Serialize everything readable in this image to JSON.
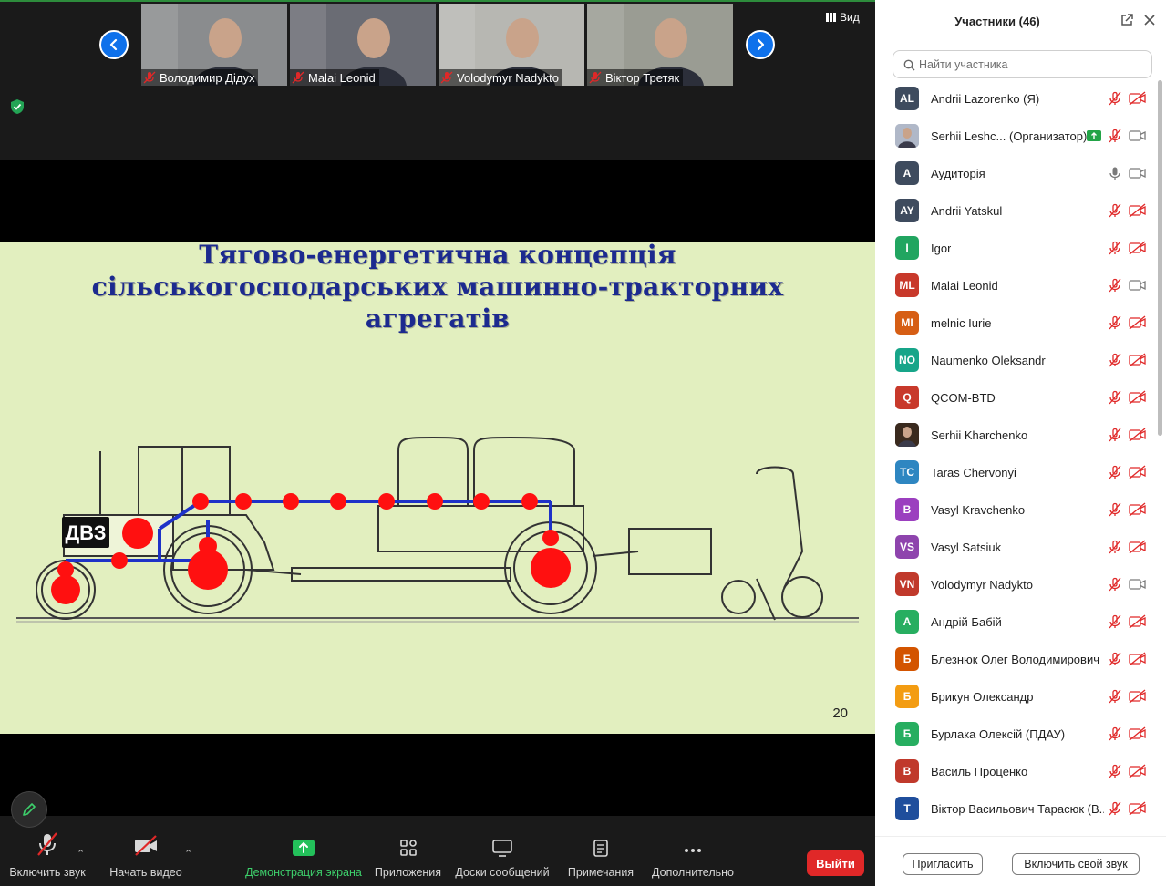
{
  "gallery": {
    "tiles": [
      {
        "name": "Володимир Дідух",
        "bg": "#8a8c8e"
      },
      {
        "name": "Malai Leonid",
        "bg": "#6a6c74"
      },
      {
        "name": "Volodymyr Nadykto",
        "bg": "#b7b7b2"
      },
      {
        "name": "Віктор Третяк",
        "bg": "#9a9c93"
      }
    ],
    "view_label": "Вид"
  },
  "slide": {
    "title_lines": [
      "Тягово-енергетична концепція",
      "сільськогосподарських машинно-тракторних",
      "агрегатів"
    ],
    "engine_label": "ДВЗ",
    "page_number": "20"
  },
  "toolbar": {
    "unmute": "Включить звук",
    "start_video": "Начать видео",
    "share_screen": "Демонстрация экрана",
    "apps": "Приложения",
    "whiteboards": "Доски сообщений",
    "notes": "Примечания",
    "more": "Дополнительно",
    "leave": "Выйти"
  },
  "panel": {
    "title": "Участники (46)",
    "search_placeholder": "Найти участника",
    "participants": [
      {
        "initials": "AL",
        "name": "Andrii Lazorenko (Я)",
        "color": "#3e4b5e",
        "mic": "muted",
        "cam": "off"
      },
      {
        "initials": "",
        "name": "Serhii Leshc... (Организатор)",
        "color": "#b0b8c8",
        "mic": "muted",
        "cam": "on",
        "photo": true,
        "sharing": true
      },
      {
        "initials": "A",
        "name": "Аудиторія",
        "color": "#3e4b5e",
        "mic": "on",
        "cam": "on"
      },
      {
        "initials": "AY",
        "name": "Andrii Yatskul",
        "color": "#3e4b5e",
        "mic": "muted",
        "cam": "off"
      },
      {
        "initials": "I",
        "name": "Igor",
        "color": "#21a560",
        "mic": "muted",
        "cam": "off"
      },
      {
        "initials": "ML",
        "name": "Malai Leonid",
        "color": "#c8392b",
        "mic": "muted",
        "cam": "on"
      },
      {
        "initials": "MI",
        "name": "melnic Iurie",
        "color": "#d65e14",
        "mic": "muted",
        "cam": "off"
      },
      {
        "initials": "NO",
        "name": "Naumenko Oleksandr",
        "color": "#17a589",
        "mic": "muted",
        "cam": "off"
      },
      {
        "initials": "Q",
        "name": "QCOM-BTD",
        "color": "#c8392b",
        "mic": "muted",
        "cam": "off"
      },
      {
        "initials": "",
        "name": "Serhii Kharchenko",
        "color": "#3a2a1e",
        "mic": "muted",
        "cam": "off",
        "photo": true
      },
      {
        "initials": "TC",
        "name": "Taras Chervonyi",
        "color": "#2e86c1",
        "mic": "muted",
        "cam": "off"
      },
      {
        "initials": "B",
        "name": "Vasyl Kravchenko",
        "color": "#9b3fbf",
        "mic": "muted",
        "cam": "off"
      },
      {
        "initials": "VS",
        "name": "Vasyl Satsiuk",
        "color": "#8e44ad",
        "mic": "muted",
        "cam": "off"
      },
      {
        "initials": "VN",
        "name": "Volodymyr Nadykto",
        "color": "#c0392b",
        "mic": "muted",
        "cam": "on"
      },
      {
        "initials": "А",
        "name": "Андрій Бабій",
        "color": "#27ae60",
        "mic": "muted",
        "cam": "off"
      },
      {
        "initials": "Б",
        "name": "Блезнюк Олег Володимирович",
        "color": "#d35400",
        "mic": "muted",
        "cam": "off"
      },
      {
        "initials": "Б",
        "name": "Брикун Олександр",
        "color": "#f39c12",
        "mic": "muted",
        "cam": "off"
      },
      {
        "initials": "Б",
        "name": "Бурлака Олексій (ПДАУ)",
        "color": "#27ae60",
        "mic": "muted",
        "cam": "off"
      },
      {
        "initials": "В",
        "name": "Василь Проценко",
        "color": "#c0392b",
        "mic": "muted",
        "cam": "off"
      },
      {
        "initials": "Т",
        "name": "Віктор Васильович Тарасюк (В...",
        "color": "#1f4e9c",
        "mic": "muted",
        "cam": "off"
      }
    ],
    "invite": "Пригласить",
    "unmute_self": "Включить свой звук"
  }
}
